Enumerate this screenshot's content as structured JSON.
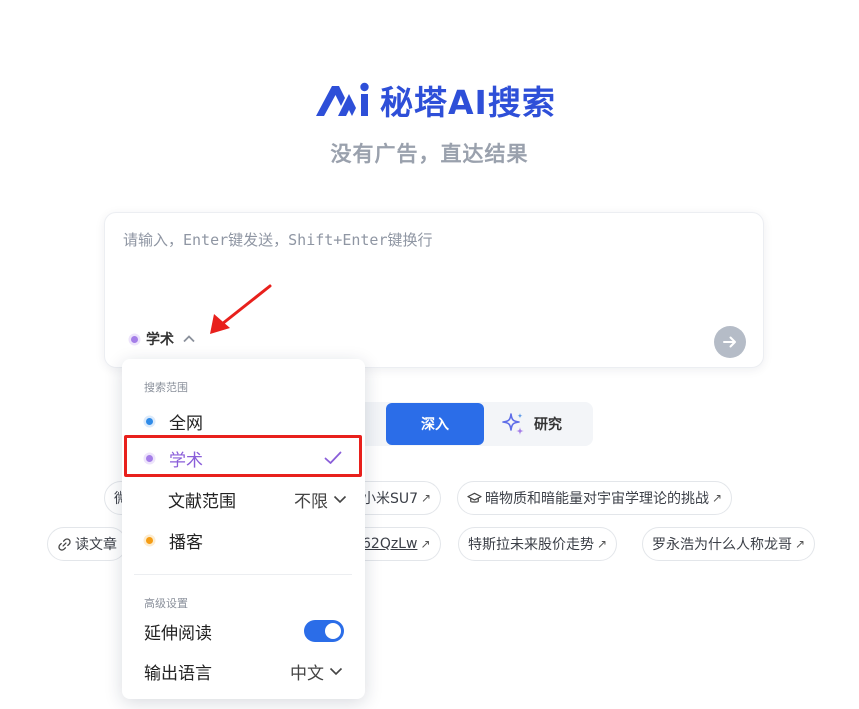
{
  "header": {
    "logo_text": "秘塔AI搜索",
    "tagline": "没有广告，直达结果",
    "logo_icon": "metaso-logo-icon",
    "brand_color": "#2e4fd8"
  },
  "search": {
    "placeholder": "请输入，Enter键发送，Shift+Enter键换行",
    "value": "",
    "scope_selected": "学术",
    "send_icon": "arrow-right-icon"
  },
  "modes": {
    "deep_label": "深入",
    "research_label": "研究",
    "active": "深入",
    "accent": "#2b6de8"
  },
  "suggestions": [
    {
      "text": "微",
      "icon": ""
    },
    {
      "text": "小米SU7",
      "icon": ""
    },
    {
      "text": "暗物质和暗能量对宇宙学理论的挑战",
      "icon": "graduation-cap-icon"
    },
    {
      "text": "读文章",
      "icon": "link-icon"
    },
    {
      "text": "62QzLw",
      "icon": ""
    },
    {
      "text": "特斯拉未来股价走势",
      "icon": ""
    },
    {
      "text": "罗永浩为什么人称龙哥",
      "icon": ""
    }
  ],
  "dropdown": {
    "scope_title": "搜索范围",
    "options": [
      {
        "label": "全网",
        "dot_color": "#2f8be8",
        "selected": false
      },
      {
        "label": "学术",
        "dot_color": "#a57ee8",
        "selected": true
      },
      {
        "label": "播客",
        "dot_color": "#f59d14",
        "selected": false
      }
    ],
    "literature": {
      "label": "文献范围",
      "value": "不限"
    },
    "advanced_title": "高级设置",
    "extended_reading": {
      "label": "延伸阅读",
      "enabled": true
    },
    "output_language": {
      "label": "输出语言",
      "value": "中文"
    }
  },
  "annotation": {
    "highlight_color": "#e8201c"
  }
}
